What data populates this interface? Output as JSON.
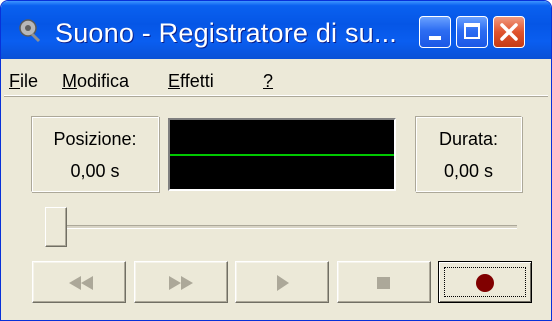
{
  "window": {
    "title": "Suono - Registratore di su...",
    "buttons": [
      "minimize-icon",
      "maximize-icon",
      "close-icon"
    ]
  },
  "menu": {
    "items": [
      {
        "label": "File",
        "accel": "F"
      },
      {
        "label": "Modifica",
        "accel": "M"
      },
      {
        "label": "Effetti",
        "accel": "E"
      },
      {
        "label": "?",
        "accel": "?"
      }
    ]
  },
  "position": {
    "label": "Posizione:",
    "value": "0,00 s"
  },
  "duration": {
    "label": "Durata:",
    "value": "0,00 s"
  },
  "waveform": {
    "background": "#000000",
    "line_color": "#00c800"
  },
  "slider": {
    "position_fraction": 0.0
  },
  "transport": {
    "buttons": [
      {
        "name": "rewind",
        "icon": "rewind-icon",
        "enabled": false
      },
      {
        "name": "fast-forward",
        "icon": "fast-forward-icon",
        "enabled": false
      },
      {
        "name": "play",
        "icon": "play-icon",
        "enabled": false
      },
      {
        "name": "stop",
        "icon": "stop-icon",
        "enabled": false
      },
      {
        "name": "record",
        "icon": "record-icon",
        "enabled": true,
        "color": "#800000"
      }
    ]
  }
}
